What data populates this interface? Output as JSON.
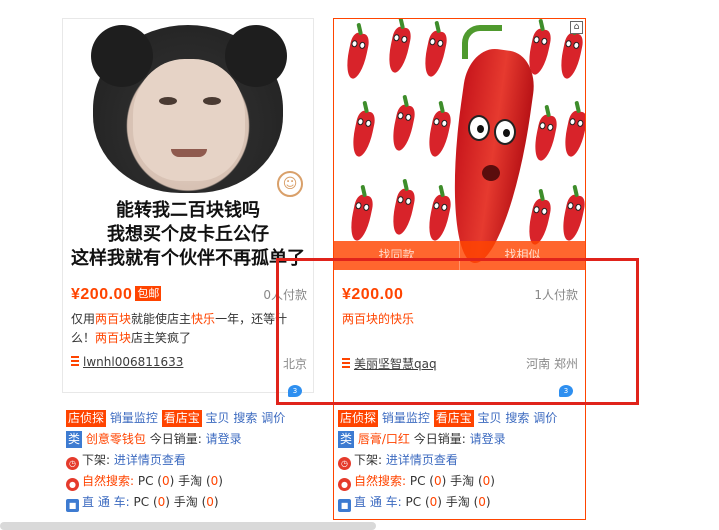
{
  "cards": [
    {
      "image_caption_lines": [
        "能转我二百块钱吗",
        "我想买个皮卡丘公仔",
        "这样我就有个伙伴不再孤单了"
      ],
      "price": "¥200.00",
      "baoyou": "包邮",
      "paid": "0人付款",
      "title_parts": [
        "仅用",
        "两百块",
        "就能使店主",
        "快乐",
        "一年，还等什么！",
        "两百块",
        "店主笑疯了"
      ],
      "shop": "lwnhl006811633",
      "location": "北京",
      "ww_badge": "3"
    },
    {
      "overlay": [
        "找同款",
        "找相似"
      ],
      "price": "¥200.00",
      "paid": "1人付款",
      "title": "两百块的快乐",
      "shop": "美丽坚智慧qaq",
      "location": "河南 郑州",
      "ww_badge": "3"
    }
  ],
  "tools": [
    {
      "row1": {
        "badge1": "店侦探",
        "link1": "销量监控",
        "badge2": "看店宝",
        "link2": "宝贝",
        "link3": "搜索",
        "link4": "调价"
      },
      "row2": {
        "badge": "类",
        "category": "创意零钱包",
        "label": "今日销量:",
        "action": "请登录"
      },
      "row3": {
        "label": "下架:",
        "action": "进详情页查看"
      },
      "row4": {
        "label": "自然搜索:",
        "pc_label": "PC (",
        "pc": "0",
        "mid": ") 手淘 (",
        "mobile": "0",
        "end": ")"
      },
      "row5": {
        "label": "直 通 车:",
        "pc_label": "PC (",
        "pc": "0",
        "mid": ") 手淘 (",
        "mobile": "0",
        "end": ")"
      }
    },
    {
      "row1": {
        "badge1": "店侦探",
        "link1": "销量监控",
        "badge2": "看店宝",
        "link2": "宝贝",
        "link3": "搜索",
        "link4": "调价"
      },
      "row2": {
        "badge": "类",
        "category": "唇膏/口红",
        "label": "今日销量:",
        "action": "请登录"
      },
      "row3": {
        "label": "下架:",
        "action": "进详情页查看"
      },
      "row4": {
        "label": "自然搜索:",
        "pc_label": "PC (",
        "pc": "0",
        "mid": ") 手淘 (",
        "mobile": "0",
        "end": ")"
      },
      "row5": {
        "label": "直 通 车:",
        "pc_label": "PC (",
        "pc": "0",
        "mid": ") 手淘 (",
        "mobile": "0",
        "end": ")"
      }
    }
  ],
  "colors": {
    "accent": "#ff4400",
    "link": "#3d6bc0",
    "highlight": "#e0231b"
  },
  "icons": [
    "shop-icon",
    "wangwang-icon",
    "clock-icon",
    "search-person-icon",
    "car-icon",
    "similar-icon"
  ]
}
